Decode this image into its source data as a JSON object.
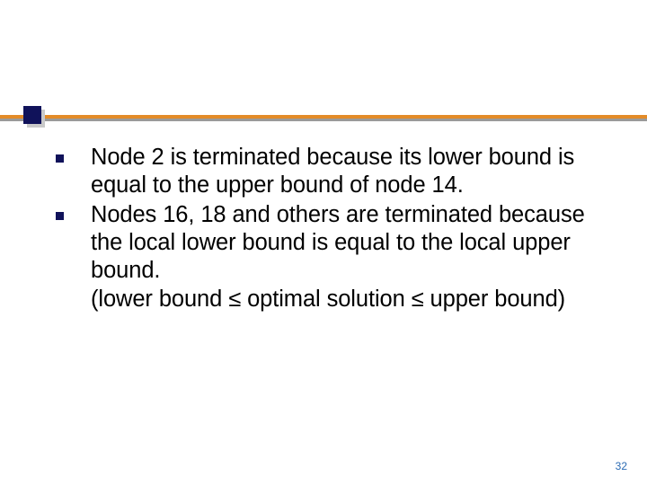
{
  "slide": {
    "bullets": [
      "Node 2 is terminated because its lower bound is equal to the upper bound of node 14.",
      "Nodes 16, 18 and others are terminated because the local lower bound is equal to the local upper bound.\n(lower bound ≤ optimal solution ≤ upper bound)"
    ],
    "page_number": "32"
  },
  "theme": {
    "accent": "#e38b27",
    "navy": "#10125a",
    "shadow": "#9a9a9a"
  }
}
